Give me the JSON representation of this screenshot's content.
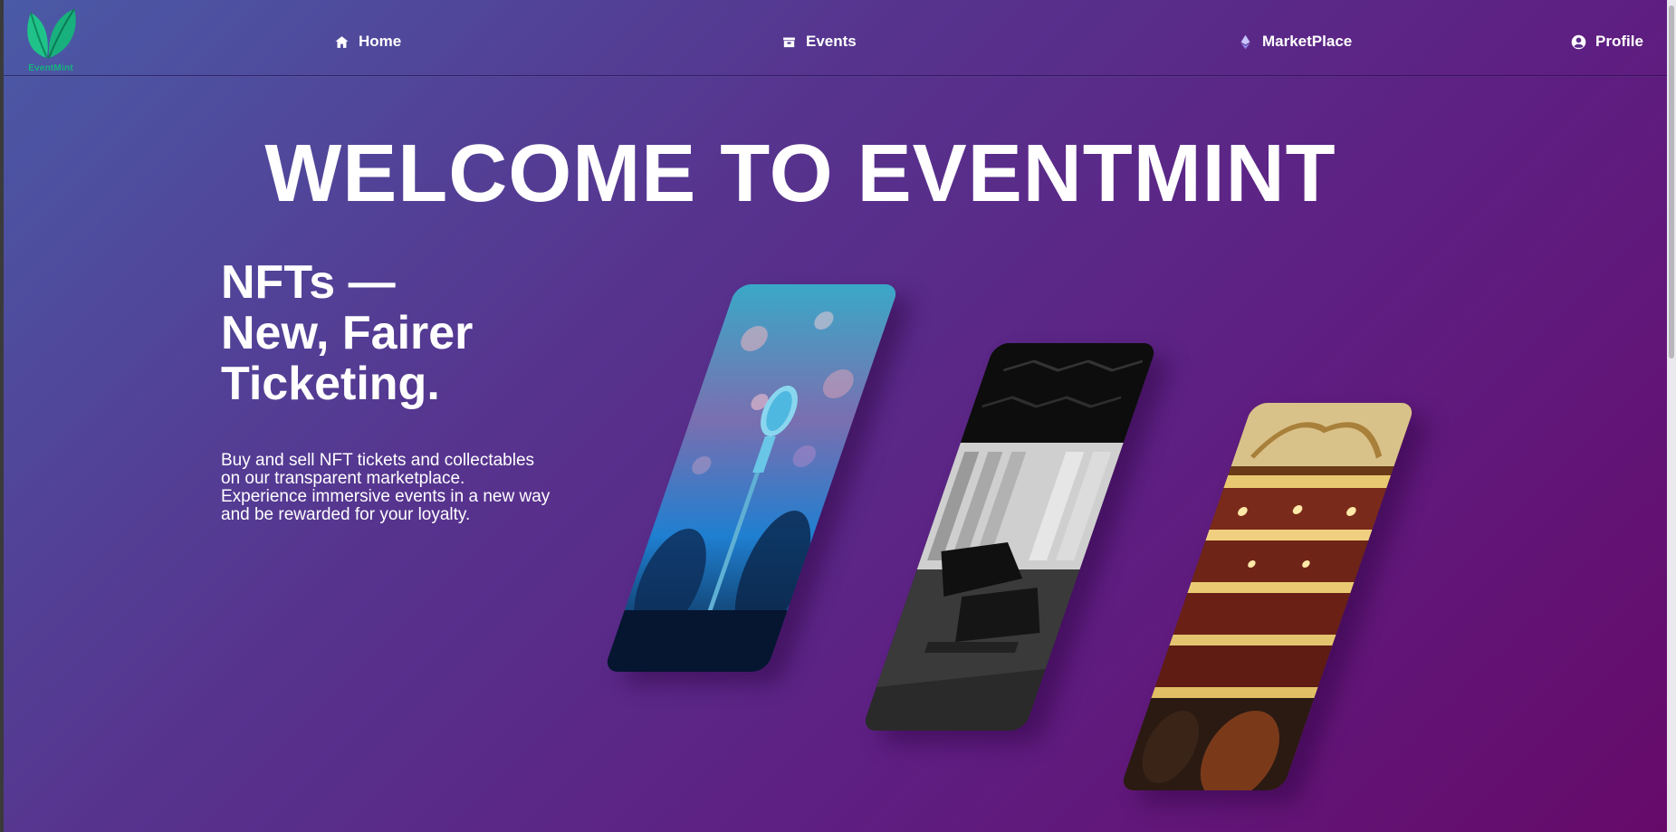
{
  "brand": {
    "name": "EventMint",
    "logo_color": "#16b37e"
  },
  "nav": {
    "items": [
      {
        "label": "Home",
        "icon": "home-icon"
      },
      {
        "label": "Events",
        "icon": "ticket-icon"
      },
      {
        "label": "MarketPlace",
        "icon": "ethereum-icon"
      },
      {
        "label": "Profile",
        "icon": "user-circle-icon"
      }
    ]
  },
  "hero": {
    "title": "WELCOME TO EVENTMINT",
    "tagline": [
      "NFTs —",
      "New, Fairer",
      "Ticketing."
    ],
    "description": [
      "Buy and sell NFT tickets and collectables",
      "on our transparent marketplace.",
      "Experience immersive events in a new way",
      "and be rewarded for your loyalty."
    ]
  },
  "cards": [
    {
      "image": "concert-microphone-image"
    },
    {
      "image": "gym-equipment-image"
    },
    {
      "image": "opera-theatre-image"
    }
  ],
  "colors": {
    "gradient_start": "#4a5aa6",
    "gradient_end": "#660a6a",
    "text": "#ffffff"
  }
}
